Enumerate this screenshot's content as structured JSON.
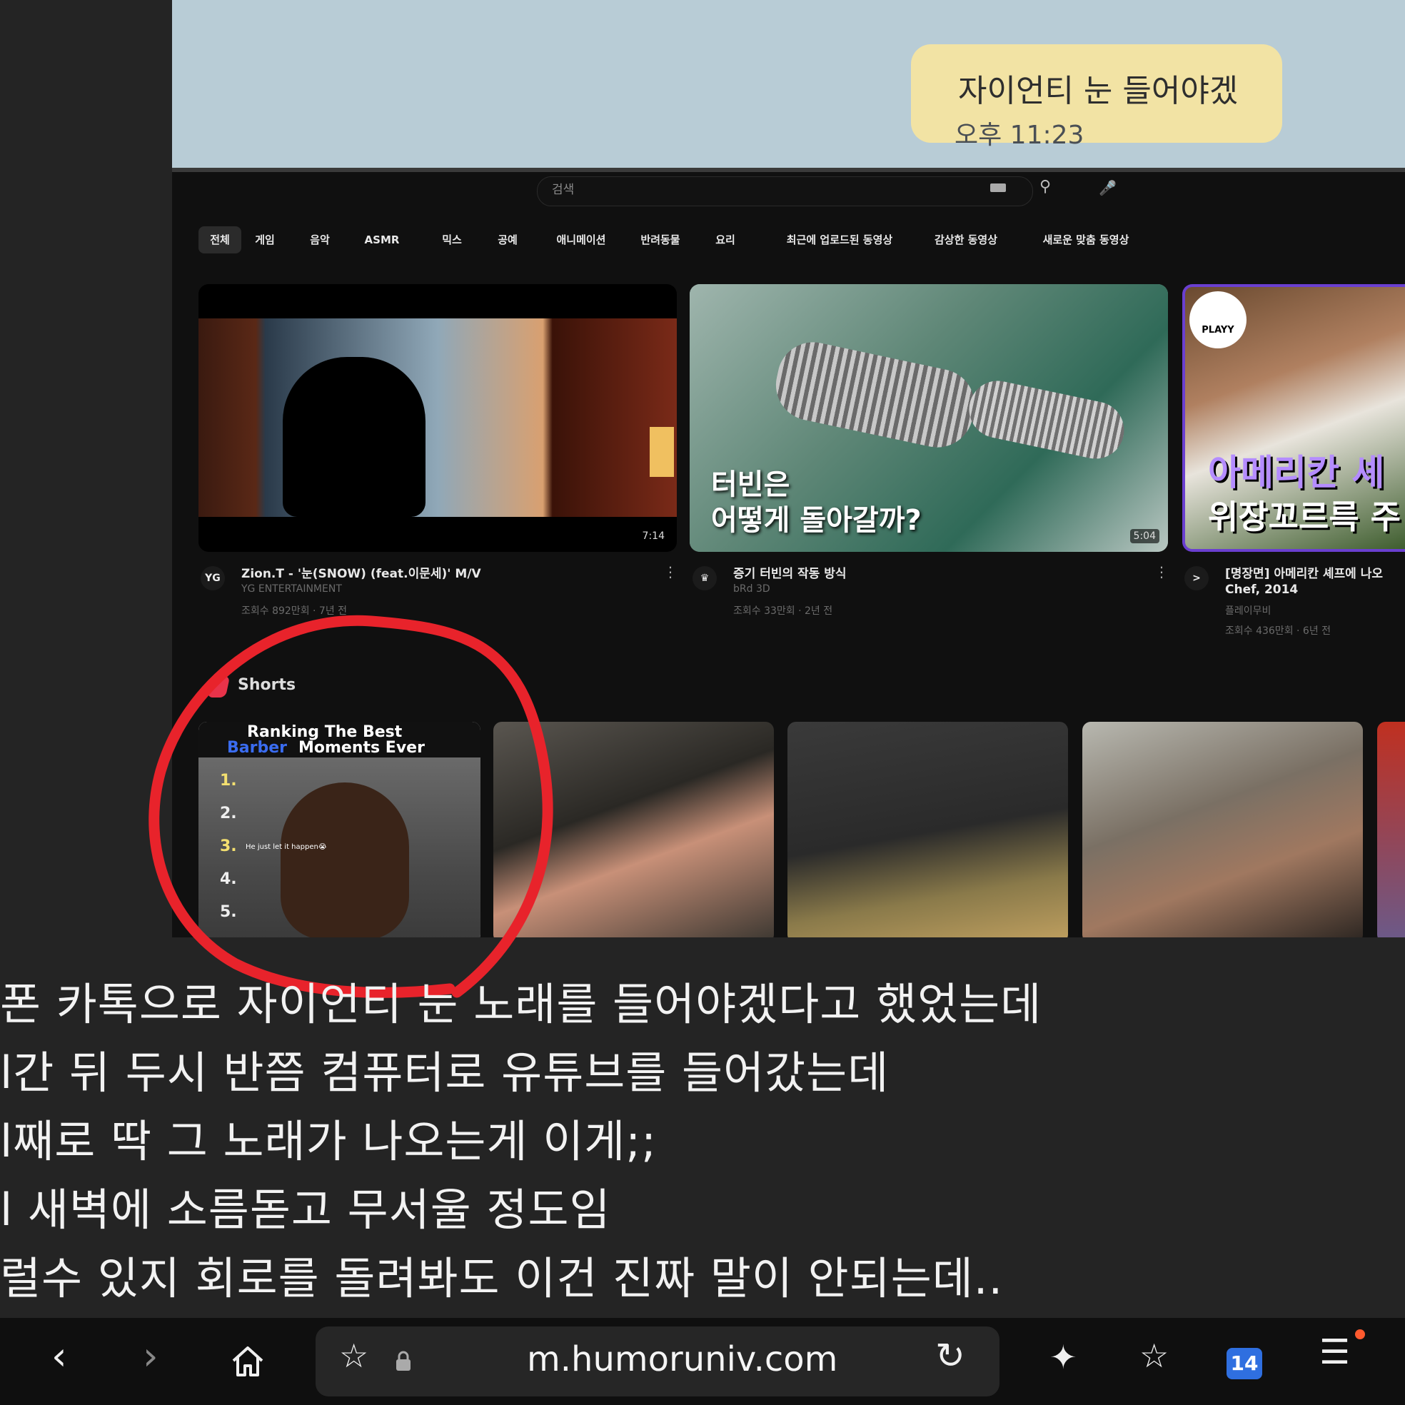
{
  "chat": {
    "bubble_text": "자이언티 눈 들어야겠",
    "time": "오후 11:23"
  },
  "youtube": {
    "search_placeholder": "검색",
    "chips": [
      "전체",
      "게임",
      "음악",
      "ASMR",
      "믹스",
      "공예",
      "애니메이션",
      "반려동물",
      "요리",
      "최근에 업로드된 동영상",
      "감상한 동영상",
      "새로운 맞춤 동영상"
    ],
    "videos": [
      {
        "title": "Zion.T - '눈(SNOW) (feat.이문세)' M/V",
        "channel": "YG ENTERTAINMENT",
        "stats": "조회수 892만회 · 7년 전",
        "duration": "7:14",
        "channel_icon": "YG"
      },
      {
        "title": "증기 터빈의 작동 방식",
        "channel": "bRd 3D",
        "stats": "조회수 33만회 · 2년 전",
        "duration": "5:04",
        "overlay_1": "터빈은",
        "overlay_2": "어떻게 돌아갈까?",
        "channel_icon": "♛"
      },
      {
        "title": "[명장면] 아메리칸 셰프에 나오",
        "title2": "Chef, 2014",
        "channel": "플레이무비",
        "stats": "조회수 436만회 · 6년 전",
        "overlay_1": "아메리칸 셰",
        "overlay_2": "위장꼬르륵 주",
        "badge": "PLAYY",
        "channel_icon": ">"
      }
    ],
    "shorts_label": "Shorts",
    "short1": {
      "line1": "Ranking The Best",
      "line2a": "Barber",
      "line2b": "Moments Ever",
      "ranks": [
        "1.",
        "2.",
        "3.",
        "4.",
        "5."
      ],
      "caption": "He just let it happen😭"
    }
  },
  "post_lines": [
    "폰 카톡으로 자이언티 눈 노래를 들어야겠다고 했었는데",
    "l간 뒤 두시 반쯤 컴퓨터로 유튜브를 들어갔는데",
    "l째로 딱 그 노래가 나오는게 이게;;",
    "l 새벽에 소름돋고 무서울 정도임",
    "럴수 있지 회로를 돌려봐도 이건 진짜 말이 안되는데.."
  ],
  "browser": {
    "url": "m.humoruniv.com",
    "tab_count": "14"
  }
}
